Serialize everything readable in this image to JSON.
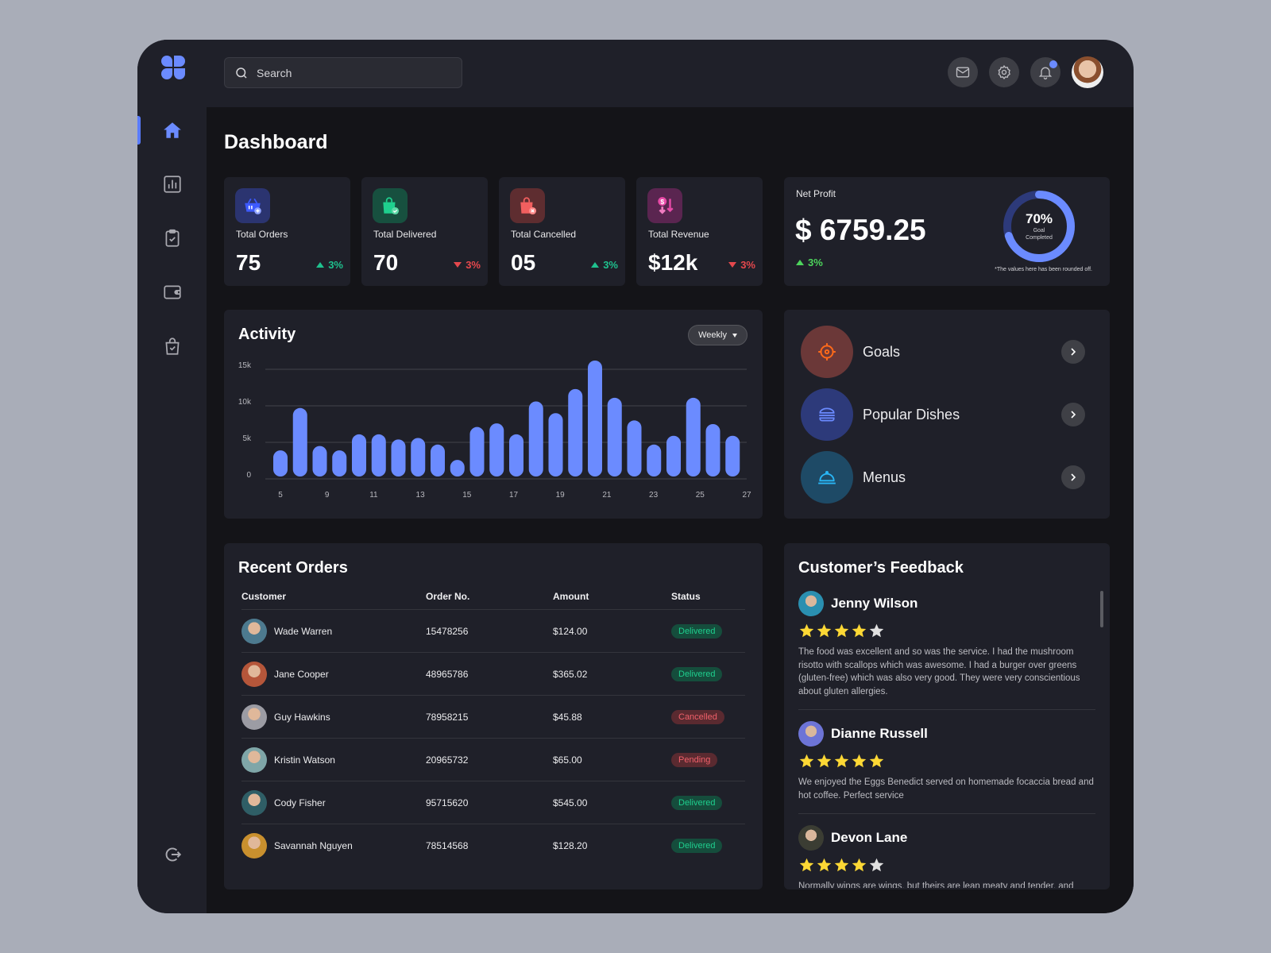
{
  "search": {
    "placeholder": "Search"
  },
  "sidebar": {
    "items": [
      {
        "name": "home",
        "active": true
      },
      {
        "name": "analytics",
        "active": false
      },
      {
        "name": "orders-clipboard",
        "active": false
      },
      {
        "name": "wallet",
        "active": false
      },
      {
        "name": "shopping-bag",
        "active": false
      }
    ],
    "logout": "logout"
  },
  "topbar": {
    "icons": [
      "mail-icon",
      "settings-icon",
      "bell-icon"
    ],
    "has_notification": true
  },
  "page": {
    "title": "Dashboard"
  },
  "stats": [
    {
      "label": "Total Orders",
      "value": "75",
      "change": "3%",
      "direction": "up",
      "icon": "basket-plus-icon",
      "color": "#3d5afe"
    },
    {
      "label": "Total Delivered",
      "value": "70",
      "change": "3%",
      "direction": "down",
      "icon": "bag-check-icon",
      "color": "#1fcf8e"
    },
    {
      "label": "Total Cancelled",
      "value": "05",
      "change": "3%",
      "direction": "up",
      "icon": "bag-x-icon",
      "color": "#f25f5f"
    },
    {
      "label": "Total Revenue",
      "value": "$12k",
      "change": "3%",
      "direction": "down",
      "icon": "revenue-down-icon",
      "color": "#e84aa8"
    }
  ],
  "net_profit": {
    "label": "Net Profit",
    "value": "$ 6759.25",
    "change": "3%",
    "goal_percent": 70,
    "goal_label": "70%",
    "goal_sub": "Goal Completed",
    "note": "*The values here has been rounded off."
  },
  "activity": {
    "title": "Activity",
    "period": "Weekly"
  },
  "chart_data": {
    "type": "bar",
    "title": "Activity",
    "xlabel": "",
    "ylabel": "",
    "ylim": [
      0,
      15000
    ],
    "yticks": [
      "0",
      "5k",
      "10k",
      "15k"
    ],
    "ytick_values": [
      0,
      5000,
      10000,
      15000
    ],
    "xtick_labels": [
      "5",
      "9",
      "11",
      "13",
      "15",
      "17",
      "19",
      "21",
      "23",
      "25",
      "27"
    ],
    "grid": true,
    "values": [
      3900,
      9700,
      4500,
      3900,
      6100,
      6100,
      5400,
      5600,
      4700,
      2600,
      7100,
      7600,
      6100,
      10600,
      9000,
      12300,
      16200,
      11100,
      8000,
      4700,
      5900,
      11100,
      7500,
      5900
    ]
  },
  "quick_links": [
    {
      "label": "Goals",
      "icon": "target-icon",
      "bg": "#6b3838",
      "fg": "#ff6a1a"
    },
    {
      "label": "Popular Dishes",
      "icon": "burger-icon",
      "bg": "#2d3a7a",
      "fg": "#6b8bff"
    },
    {
      "label": "Menus",
      "icon": "cloche-icon",
      "bg": "#1e4a66",
      "fg": "#29b6f6"
    }
  ],
  "recent_orders": {
    "title": "Recent Orders",
    "columns": [
      "Customer",
      "Order No.",
      "Amount",
      "Status"
    ],
    "rows": [
      {
        "customer": "Wade Warren",
        "order_no": "15478256",
        "amount": "$124.00",
        "status": "Delivered",
        "avatar": "#4d7a8f"
      },
      {
        "customer": "Jane Cooper",
        "order_no": "48965786",
        "amount": "$365.02",
        "status": "Delivered",
        "avatar": "#b5563a"
      },
      {
        "customer": "Guy Hawkins",
        "order_no": "78958215",
        "amount": "$45.88",
        "status": "Cancelled",
        "avatar": "#9c9ca4"
      },
      {
        "customer": "Kristin Watson",
        "order_no": "20965732",
        "amount": "$65.00",
        "status": "Pending",
        "avatar": "#7fa6a8"
      },
      {
        "customer": "Cody Fisher",
        "order_no": "95715620",
        "amount": "$545.00",
        "status": "Delivered",
        "avatar": "#2f5e66"
      },
      {
        "customer": "Savannah Nguyen",
        "order_no": "78514568",
        "amount": "$128.20",
        "status": "Delivered",
        "avatar": "#c9902e"
      }
    ]
  },
  "feedback": {
    "title": "Customer’s Feedback",
    "items": [
      {
        "name": "Jenny Wilson",
        "rating": 4,
        "text": "The food was excellent and so was the service.  I had the mushroom risotto with scallops which was awesome. I had a burger over greens (gluten-free) which was also very good. They were very conscientious about gluten allergies.",
        "avatar": "#2a8fb0"
      },
      {
        "name": "Dianne Russell",
        "rating": 5,
        "text": "We enjoyed the Eggs Benedict served on homemade focaccia bread and hot coffee.  Perfect  service",
        "avatar": "#6d74d6"
      },
      {
        "name": "Devon Lane",
        "rating": 4,
        "text": "Normally wings are wings, but theirs are lean meaty and tender, and",
        "avatar": "#3b3d33"
      }
    ]
  }
}
